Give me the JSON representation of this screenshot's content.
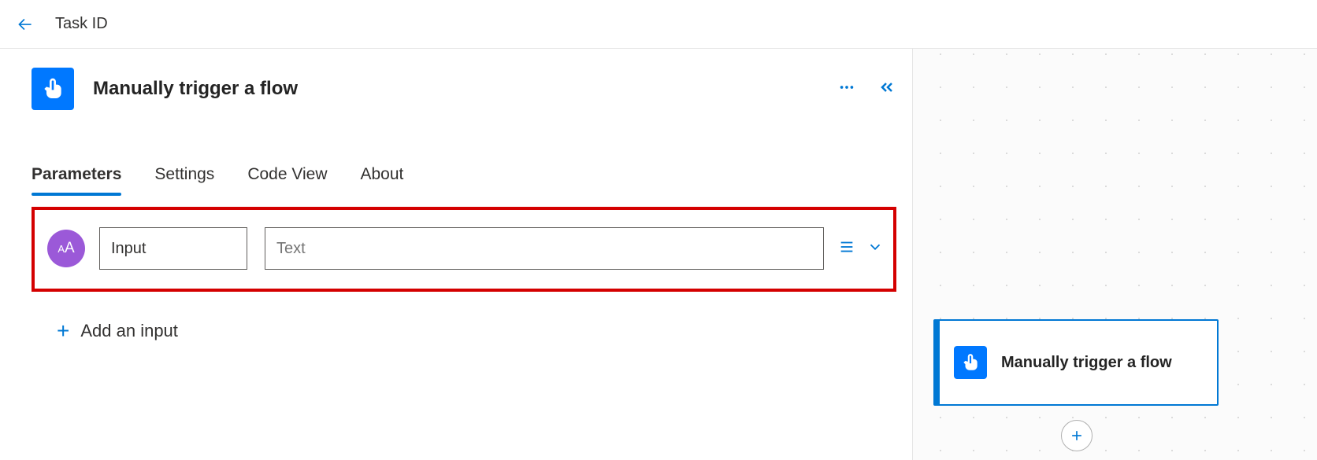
{
  "header": {
    "page_title": "Task ID"
  },
  "panel": {
    "trigger_title": "Manually trigger a flow",
    "tabs": [
      {
        "label": "Parameters"
      },
      {
        "label": "Settings"
      },
      {
        "label": "Code View"
      },
      {
        "label": "About"
      }
    ],
    "input_row": {
      "type_indicator": "AA",
      "name_value": "Input",
      "value_placeholder": "Text"
    },
    "add_input_label": "Add an input"
  },
  "canvas": {
    "node_title": "Manually trigger a flow"
  }
}
